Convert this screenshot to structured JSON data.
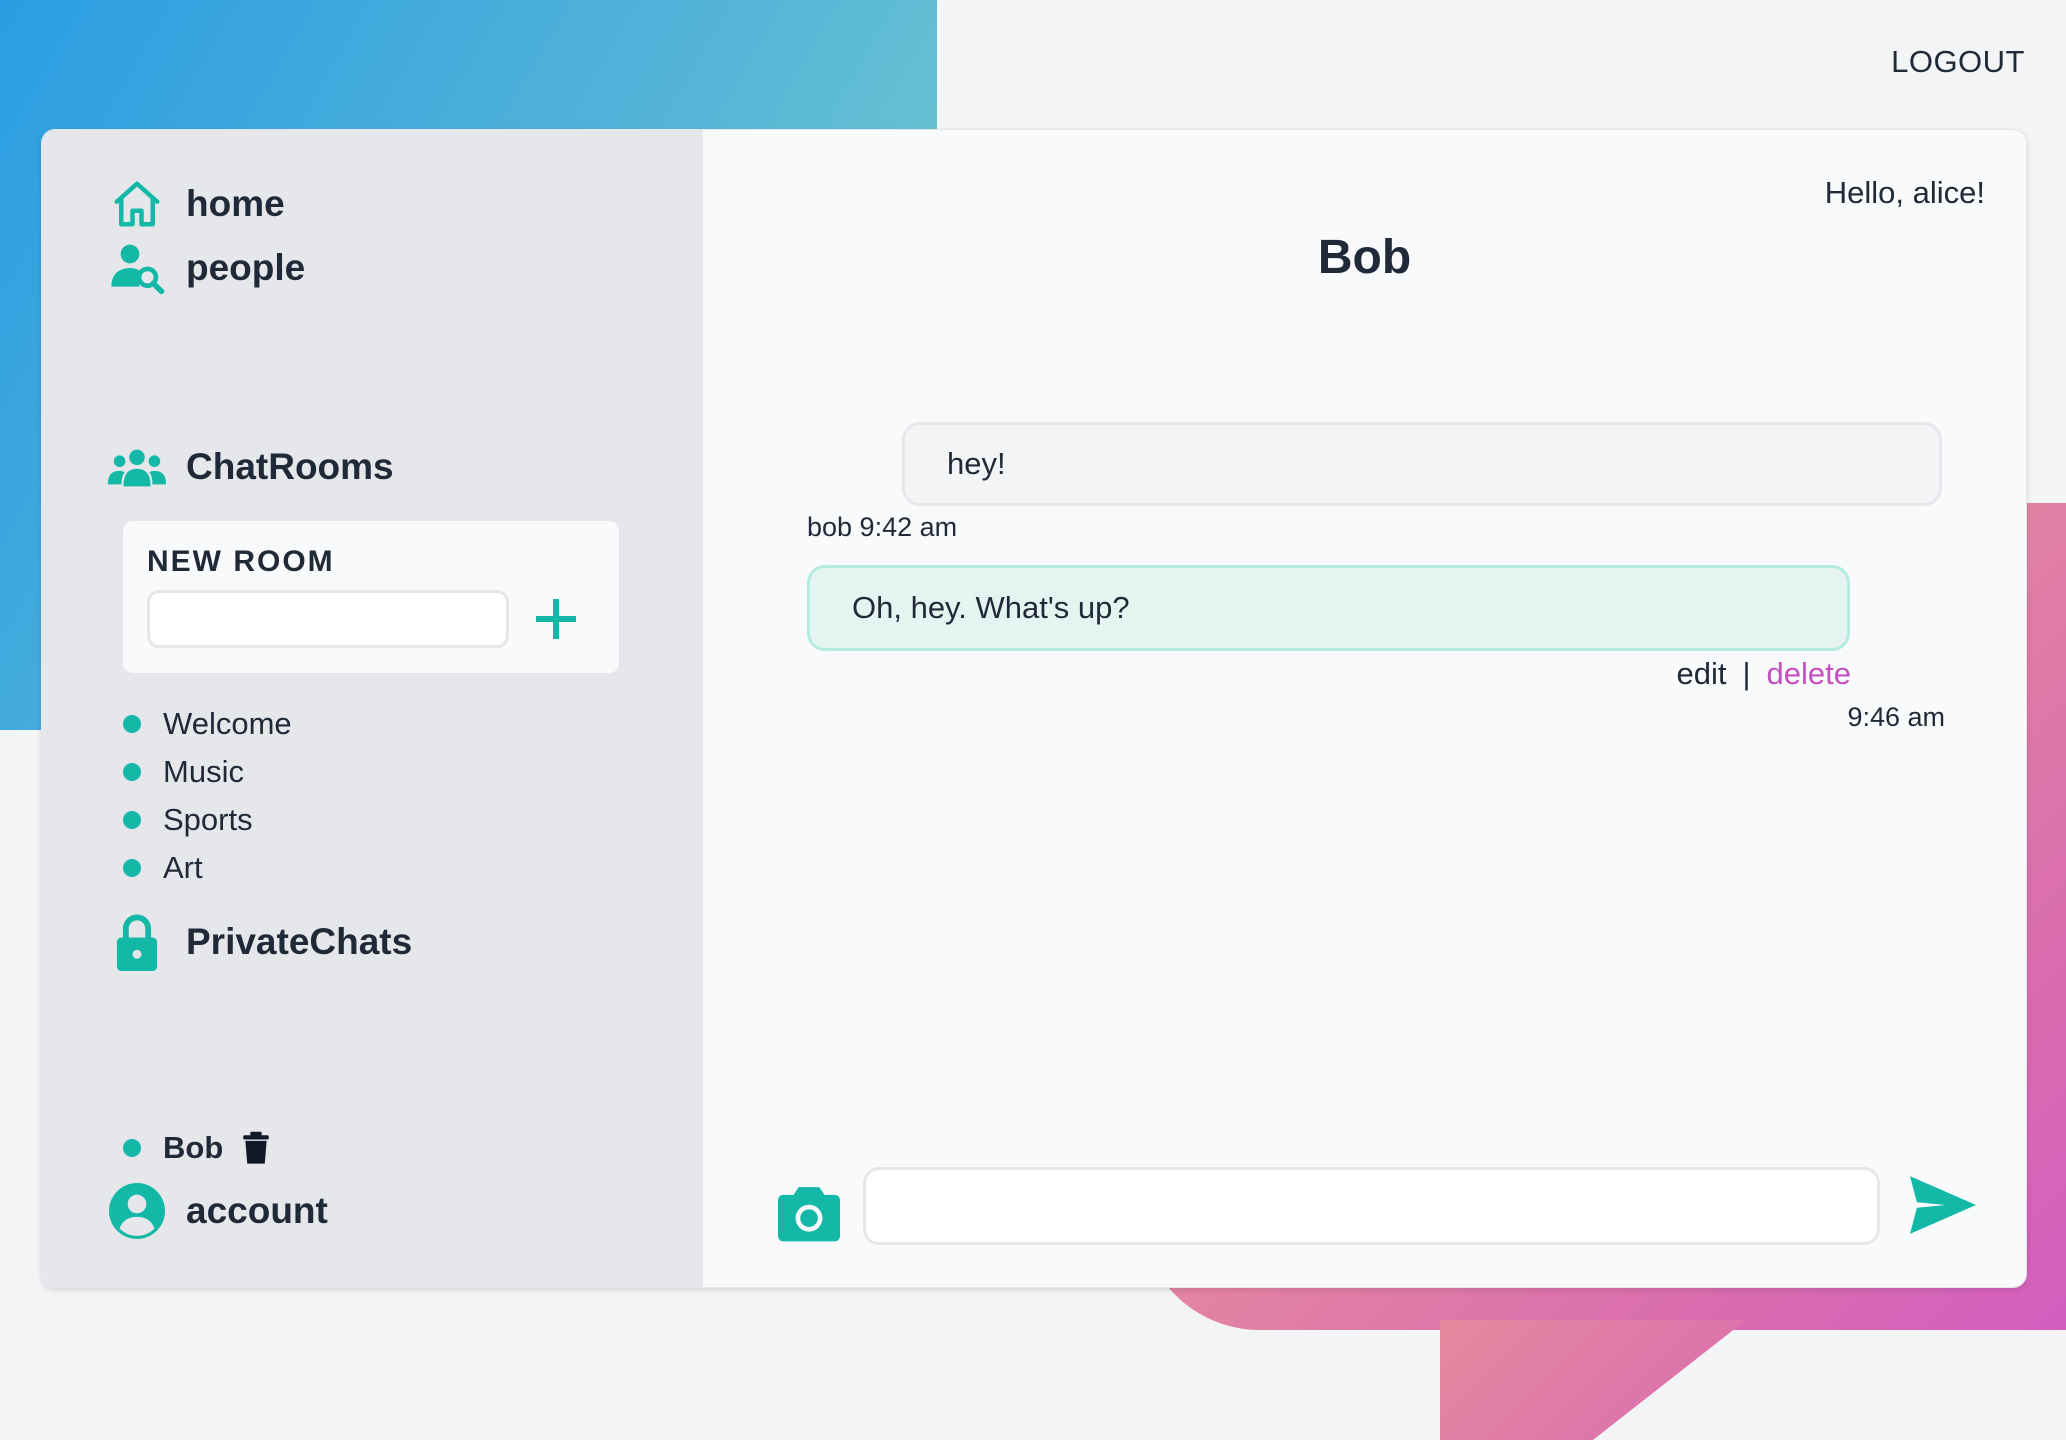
{
  "header": {
    "logout_label": "LOGOUT"
  },
  "sidebar": {
    "nav": {
      "home_label": "home",
      "people_label": "people"
    },
    "chatrooms": {
      "title": "ChatRooms",
      "new_room": {
        "title": "NEW ROOM",
        "input_value": "",
        "add_icon": "plus-icon"
      },
      "rooms": [
        {
          "label": "Welcome"
        },
        {
          "label": "Music"
        },
        {
          "label": "Sports"
        },
        {
          "label": "Art"
        }
      ]
    },
    "private_chats": {
      "title": "PrivateChats",
      "chats": [
        {
          "label": "Bob",
          "icon": "trash-icon"
        }
      ]
    },
    "account_label": "account"
  },
  "main": {
    "greeting": "Hello, alice!",
    "chat_title": "Bob",
    "messages": [
      {
        "text": "hey!",
        "author_time": "bob 9:42 am"
      },
      {
        "text": "Oh, hey. What's up?",
        "edit_label": "edit",
        "separator": "|",
        "delete_label": "delete",
        "time": "9:46 am"
      }
    ],
    "composer": {
      "input_value": "",
      "camera_icon": "camera-icon",
      "send_icon": "send-icon"
    }
  },
  "colors": {
    "accent": "#14b8a6",
    "delete": "#c54fc0",
    "sidebar_bg": "#e5e7eb",
    "main_bg": "#f8fafc",
    "outgoing_bubble": "#e6f4f1"
  }
}
